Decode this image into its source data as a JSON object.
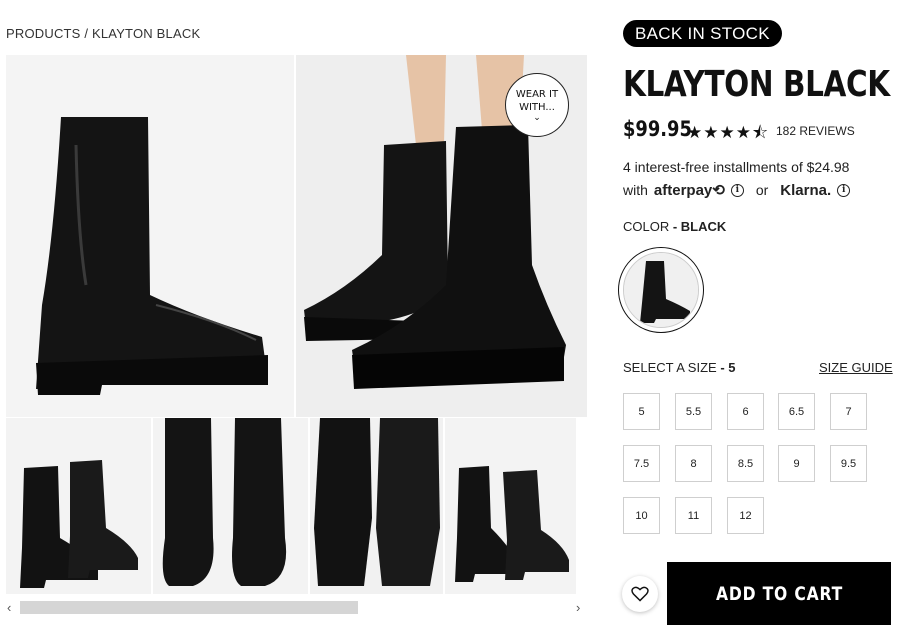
{
  "breadcrumb": "PRODUCTS / KLAYTON BLACK",
  "wear_badge": {
    "line1": "WEAR IT",
    "line2": "WITH...",
    "chevron": "⌄"
  },
  "product": {
    "badge": "BACK IN STOCK",
    "title": "KLAYTON BLACK",
    "price": "$99.95",
    "rating": 4.5,
    "stars_text": "★★★★⯪",
    "reviews": "182 REVIEWS"
  },
  "installments": {
    "line1": "4 interest-free installments of $24.98",
    "with": "with",
    "afterpay": "afterpay⟲",
    "or": "or",
    "klarna": "Klarna.",
    "info_glyph": "i"
  },
  "color": {
    "label": "COLOR",
    "value": " - BLACK"
  },
  "size": {
    "label": "SELECT A SIZE",
    "value": " - 5",
    "guide": "SIZE GUIDE",
    "options": [
      "5",
      "5.5",
      "6",
      "6.5",
      "7",
      "7.5",
      "8",
      "8.5",
      "9",
      "9.5",
      "10",
      "11",
      "12"
    ]
  },
  "actions": {
    "add_to_cart": "ADD TO CART",
    "wishlist_icon": "heart-icon"
  },
  "scroll": {
    "left": "‹",
    "right": "›"
  },
  "colors": {
    "accent": "#000000",
    "border": "#cfcfcf",
    "image_bg": "#f2f2f2"
  }
}
